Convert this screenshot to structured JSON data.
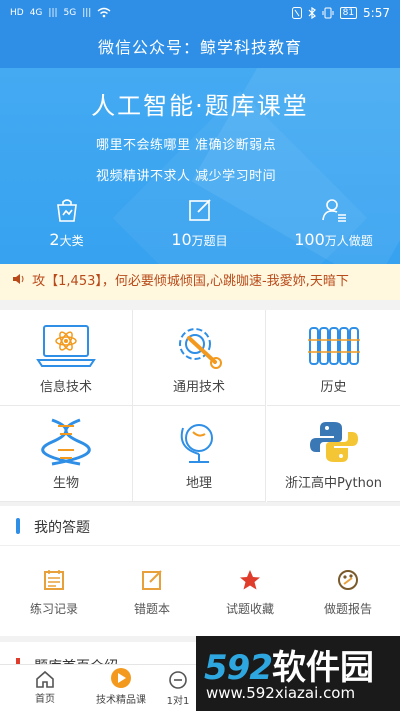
{
  "status_bar": {
    "left_icons": [
      "HD",
      "4G",
      "|||",
      "5G",
      "|||",
      "wifi"
    ],
    "right_icons": [
      "nfc-icon",
      "bluetooth-icon",
      "vibrate-icon"
    ],
    "battery": "81",
    "time": "5:57"
  },
  "title_bar": {
    "title": "微信公众号：鲸学科技教育"
  },
  "hero": {
    "title": "人工智能·题库课堂",
    "line1": "哪里不会练哪里  准确诊断弱点",
    "line2": "视频精讲不求人  减少学习时间",
    "stats": [
      {
        "num": "2",
        "unit": "大类",
        "icon": "bag-icon"
      },
      {
        "num": "10",
        "unit": "万题目",
        "icon": "edit-icon"
      },
      {
        "num": "100",
        "unit": "万人做题",
        "icon": "user-icon"
      }
    ]
  },
  "marquee": {
    "text": "攻【1,453】，何必要倾城倾国,心跳咖速-我愛妳,天暗下"
  },
  "subjects": [
    {
      "label": "信息技术",
      "icon": "laptop-atom-icon"
    },
    {
      "label": "通用技术",
      "icon": "gear-wrench-icon"
    },
    {
      "label": "历史",
      "icon": "scroll-icon"
    },
    {
      "label": "生物",
      "icon": "dna-icon"
    },
    {
      "label": "地理",
      "icon": "globe-icon"
    },
    {
      "label": "浙江高中Python",
      "icon": "python-icon"
    }
  ],
  "my_answers": {
    "title": "我的答题",
    "actions": [
      {
        "label": "练习记录",
        "icon": "calendar-icon",
        "color": "#e8a13a"
      },
      {
        "label": "错题本",
        "icon": "edit-icon",
        "color": "#e8a13a"
      },
      {
        "label": "试题收藏",
        "icon": "star-icon",
        "color": "#e03c2c"
      },
      {
        "label": "做题报告",
        "icon": "palette-icon",
        "color": "#7a5a2a"
      }
    ]
  },
  "next_section": {
    "title": "题库首页介绍"
  },
  "tabbar": {
    "tabs": [
      {
        "label": "首页"
      },
      {
        "label": "技术精品课"
      },
      {
        "label": "1对1"
      }
    ]
  },
  "watermark": {
    "brand_num": "592",
    "brand_text": "软件园",
    "url": "www.592xiazai.com"
  },
  "colors": {
    "primary": "#2f8fe6",
    "hero": "#3da7f1",
    "accent_orange": "#f39a1e",
    "marquee_text": "#b84a1a"
  }
}
